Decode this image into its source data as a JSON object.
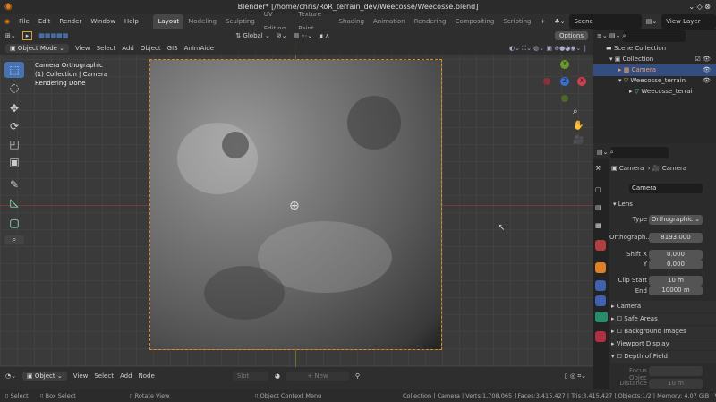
{
  "title": "Blender* [/home/chris/RoR_terrain_dev/Weecosse/Weecosse.blend]",
  "menu": [
    "File",
    "Edit",
    "Render",
    "Window",
    "Help"
  ],
  "workspaces": [
    "Layout",
    "Modeling",
    "Sculpting",
    "UV Editing",
    "Texture Paint",
    "Shading",
    "Animation",
    "Rendering",
    "Compositing",
    "Scripting"
  ],
  "scene": "Scene",
  "view_layer": "View Layer",
  "header": {
    "orientation": "Global",
    "options": "Options",
    "mode": "Object Mode",
    "menus": [
      "View",
      "Select",
      "Add",
      "Object",
      "GIS",
      "AnimAide"
    ]
  },
  "overlay": {
    "line1": "Camera Orthographic",
    "line2": "(1) Collection | Camera",
    "line3": "Rendering Done"
  },
  "gizmo": {
    "y": "Y",
    "x": "X",
    "z": "Z"
  },
  "outliner": {
    "root": "Scene Collection",
    "collection": "Collection",
    "items": [
      "Camera",
      "Weecosse_terrain",
      "Weecosse_terrai"
    ]
  },
  "props": {
    "obj": "Camera",
    "data": "Camera",
    "datablock": "Camera",
    "lens": "Lens",
    "type_label": "Type",
    "type": "Orthographic",
    "ortho_label": "Orthograph...",
    "ortho": "8193.000",
    "shiftx_label": "Shift X",
    "shiftx": "0.000",
    "shifty_label": "Y",
    "shifty": "0.000",
    "clipstart_label": "Clip Start",
    "clipstart": "10 m",
    "end_label": "End",
    "end": "10000 m",
    "panels": [
      "Camera",
      "Safe Areas",
      "Background Images",
      "Viewport Display",
      "Depth of Field"
    ],
    "focus_label": "Focus Objec",
    "distance_label": "Distance",
    "distance": "10 m"
  },
  "bottom": {
    "editor": "Object",
    "menus": [
      "View",
      "Select",
      "Add",
      "Node"
    ],
    "slot": "Slot",
    "new": "New"
  },
  "status": {
    "select": "Select",
    "box": "Box Select",
    "rotate": "Rotate View",
    "context": "Object Context Menu",
    "stats": "Collection | Camera | Verts:1,708,065 | Faces:3,415,427 | Tris:3,415,427 | Objects:1/2 | Memory: 4.07 GiB | VRAM: 1.3"
  }
}
